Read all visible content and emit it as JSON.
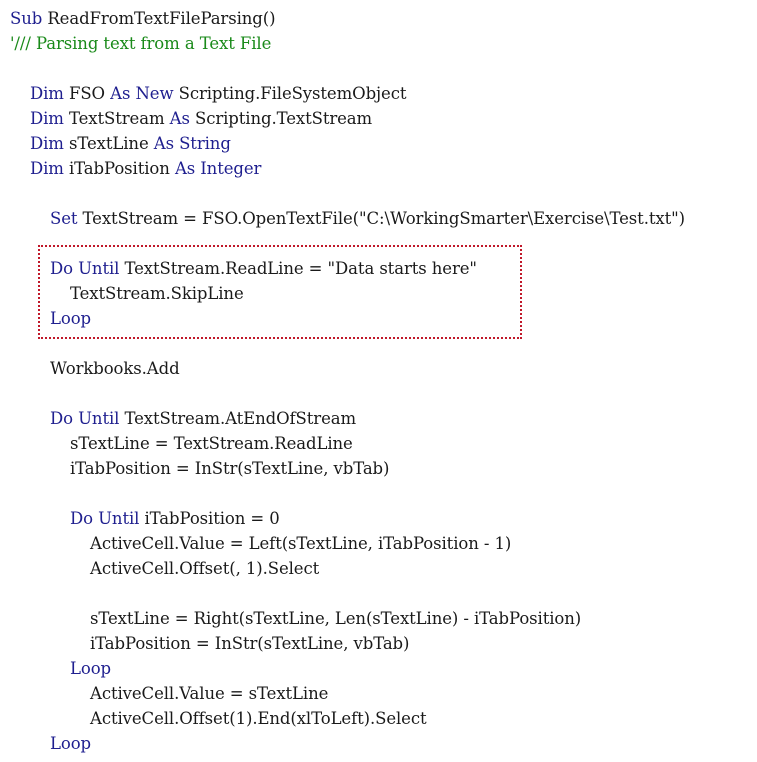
{
  "code": {
    "lines": [
      {
        "indent": 0,
        "segments": [
          {
            "t": "kw",
            "s": "Sub "
          },
          {
            "t": "tx",
            "s": "ReadFromTextFileParsing()"
          }
        ]
      },
      {
        "indent": 0,
        "segments": [
          {
            "t": "cm",
            "s": "'/// Parsing text from a Text File"
          }
        ]
      },
      {
        "indent": 0,
        "segments": []
      },
      {
        "indent": 1,
        "segments": [
          {
            "t": "kw",
            "s": "Dim "
          },
          {
            "t": "tx",
            "s": "FSO "
          },
          {
            "t": "kw",
            "s": "As New "
          },
          {
            "t": "tx",
            "s": "Scripting.FileSystemObject"
          }
        ]
      },
      {
        "indent": 1,
        "segments": [
          {
            "t": "kw",
            "s": "Dim "
          },
          {
            "t": "tx",
            "s": "TextStream "
          },
          {
            "t": "kw",
            "s": "As "
          },
          {
            "t": "tx",
            "s": "Scripting.TextStream"
          }
        ]
      },
      {
        "indent": 1,
        "segments": [
          {
            "t": "kw",
            "s": "Dim "
          },
          {
            "t": "tx",
            "s": "sTextLine "
          },
          {
            "t": "kw",
            "s": "As String"
          }
        ]
      },
      {
        "indent": 1,
        "segments": [
          {
            "t": "kw",
            "s": "Dim "
          },
          {
            "t": "tx",
            "s": "iTabPosition "
          },
          {
            "t": "kw",
            "s": "As Integer"
          }
        ]
      },
      {
        "indent": 0,
        "segments": []
      },
      {
        "indent": 2,
        "segments": [
          {
            "t": "kw",
            "s": "Set "
          },
          {
            "t": "tx",
            "s": "TextStream = FSO.OpenTextFile(\"C:\\WorkingSmarter\\Exercise\\Test.txt\")"
          }
        ]
      },
      {
        "indent": 0,
        "segments": []
      },
      {
        "indent": 2,
        "segments": [
          {
            "t": "kw",
            "s": "Do Until "
          },
          {
            "t": "tx",
            "s": "TextStream.ReadLine = \"Data starts here\""
          }
        ]
      },
      {
        "indent": 3,
        "segments": [
          {
            "t": "tx",
            "s": "TextStream.SkipLine"
          }
        ]
      },
      {
        "indent": 2,
        "segments": [
          {
            "t": "kw",
            "s": "Loop"
          }
        ]
      },
      {
        "indent": 0,
        "segments": []
      },
      {
        "indent": 2,
        "segments": [
          {
            "t": "tx",
            "s": "Workbooks.Add"
          }
        ]
      },
      {
        "indent": 0,
        "segments": []
      },
      {
        "indent": 2,
        "segments": [
          {
            "t": "kw",
            "s": "Do Until "
          },
          {
            "t": "tx",
            "s": "TextStream.AtEndOfStream"
          }
        ]
      },
      {
        "indent": 3,
        "segments": [
          {
            "t": "tx",
            "s": "sTextLine = TextStream.ReadLine"
          }
        ]
      },
      {
        "indent": 3,
        "segments": [
          {
            "t": "tx",
            "s": "iTabPosition = InStr(sTextLine, vbTab)"
          }
        ]
      },
      {
        "indent": 0,
        "segments": []
      },
      {
        "indent": 3,
        "segments": [
          {
            "t": "kw",
            "s": "Do Until "
          },
          {
            "t": "tx",
            "s": "iTabPosition = 0"
          }
        ]
      },
      {
        "indent": 4,
        "segments": [
          {
            "t": "tx",
            "s": "ActiveCell.Value = Left(sTextLine, iTabPosition - 1)"
          }
        ]
      },
      {
        "indent": 4,
        "segments": [
          {
            "t": "tx",
            "s": "ActiveCell.Offset(, 1).Select"
          }
        ]
      },
      {
        "indent": 0,
        "segments": []
      },
      {
        "indent": 4,
        "segments": [
          {
            "t": "tx",
            "s": "sTextLine = Right(sTextLine, Len(sTextLine) - iTabPosition)"
          }
        ]
      },
      {
        "indent": 4,
        "segments": [
          {
            "t": "tx",
            "s": "iTabPosition = InStr(sTextLine, vbTab)"
          }
        ]
      },
      {
        "indent": 3,
        "segments": [
          {
            "t": "kw",
            "s": "Loop"
          }
        ]
      },
      {
        "indent": 4,
        "segments": [
          {
            "t": "tx",
            "s": "ActiveCell.Value = sTextLine"
          }
        ]
      },
      {
        "indent": 4,
        "segments": [
          {
            "t": "tx",
            "s": "ActiveCell.Offset(1).End(xlToLeft).Select"
          }
        ]
      },
      {
        "indent": 2,
        "segments": [
          {
            "t": "kw",
            "s": "Loop"
          }
        ]
      }
    ]
  },
  "colors": {
    "keyword": "#1f1f8f",
    "comment": "#1a8a1a",
    "text": "#1a1a1a",
    "highlight_border": "#c0182a"
  }
}
